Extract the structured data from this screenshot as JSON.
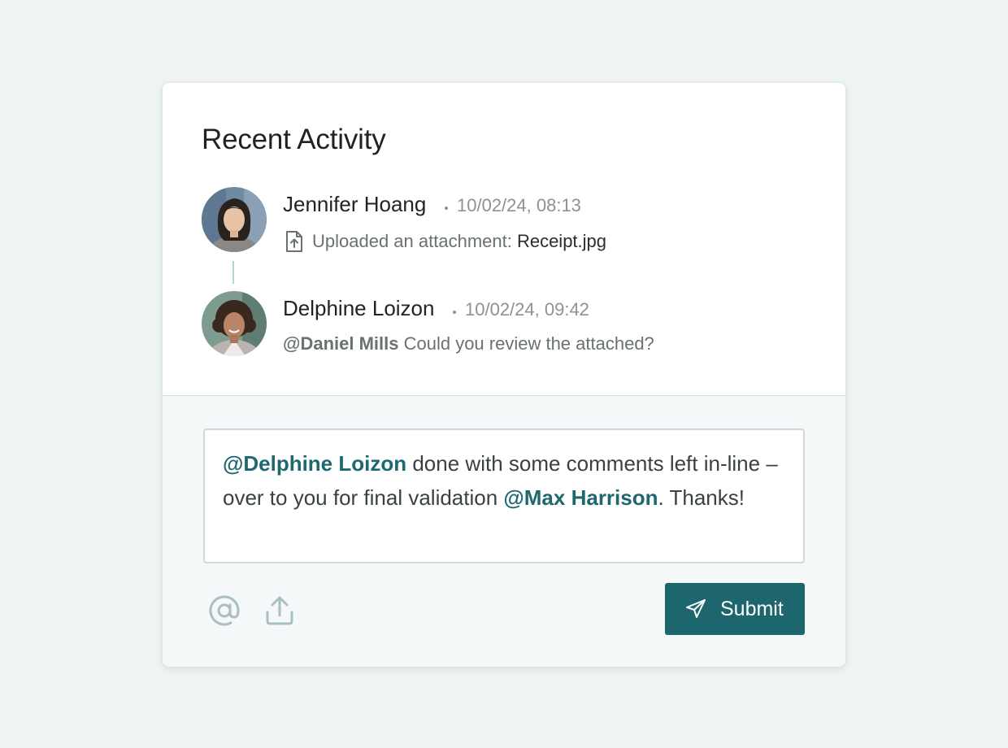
{
  "title": "Recent Activity",
  "activities": [
    {
      "name": "Jennifer Hoang",
      "timestamp": "10/02/24, 08:13",
      "action": "Uploaded an attachment: ",
      "file": "Receipt.jpg",
      "icon": "file-upload-icon"
    },
    {
      "name": "Delphine Loizon",
      "timestamp": "10/02/24, 09:42",
      "mention": "@Daniel Mills",
      "message": " Could you review the attached?"
    }
  ],
  "composer": {
    "mention_1": "@Delphine Loizon",
    "text_1": " done with some comments left in-line – over to you for final validation ",
    "mention_2": "@Max Harrison",
    "text_2": ". Thanks!"
  },
  "toolbar": {
    "mention_icon": "at-sign-icon",
    "upload_icon": "upload-icon"
  },
  "submit_label": "Submit",
  "colors": {
    "accent": "#1e666e",
    "mention": "#1e6870",
    "background": "#eff4f4"
  }
}
